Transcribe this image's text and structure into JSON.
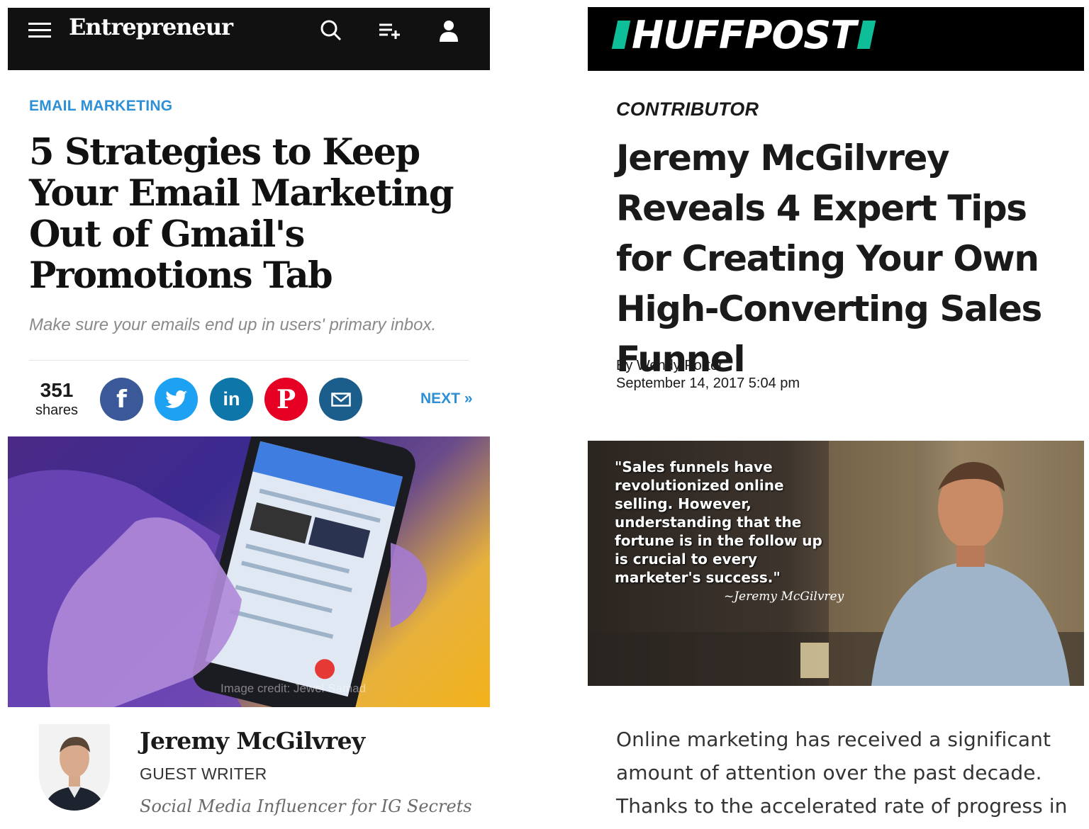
{
  "entrepreneur": {
    "logo": "Entrepreneur",
    "kicker": "EMAIL MARKETING",
    "title": "5 Strategies to Keep Your Email Marketing Out of Gmail's Promotions Tab",
    "subtitle": "Make sure your emails end up in users' primary inbox.",
    "shares_count": "351",
    "shares_label": "shares",
    "next_label": "NEXT »",
    "social": {
      "facebook": "f",
      "twitter_color": "#1da1f2",
      "linkedin": "in",
      "pinterest": "P"
    },
    "image_credit": "Image credit: Jewel Samad",
    "author": {
      "name": "Jeremy McGilvrey",
      "role": "GUEST WRITER",
      "bio": "Social Media Influencer for IG Secrets"
    },
    "colors": {
      "accent": "#2d8fd5",
      "facebook": "#3b5998",
      "linkedin": "#0e76a8",
      "pinterest": "#e60023",
      "email": "#1b5e8c"
    }
  },
  "huffpost": {
    "logo": "HUFFPOST",
    "kicker": "CONTRIBUTOR",
    "title": "Jeremy McGilvrey Reveals 4 Expert Tips for Creating Your Own High-Converting Sales Funnel",
    "byline": "By Wendy Porter",
    "date": "September 14, 2017 5:04 pm",
    "quote": "\"Sales funnels have revolutionized online selling. However, understanding that the fortune is in the follow up is crucial to every marketer's success.\"",
    "signature": "~Jeremy McGilvrey",
    "body": "Online marketing has received a significant amount of attention over the past decade. Thanks to the accelerated rate of progress in",
    "colors": {
      "brand": "#0dbe98"
    }
  }
}
